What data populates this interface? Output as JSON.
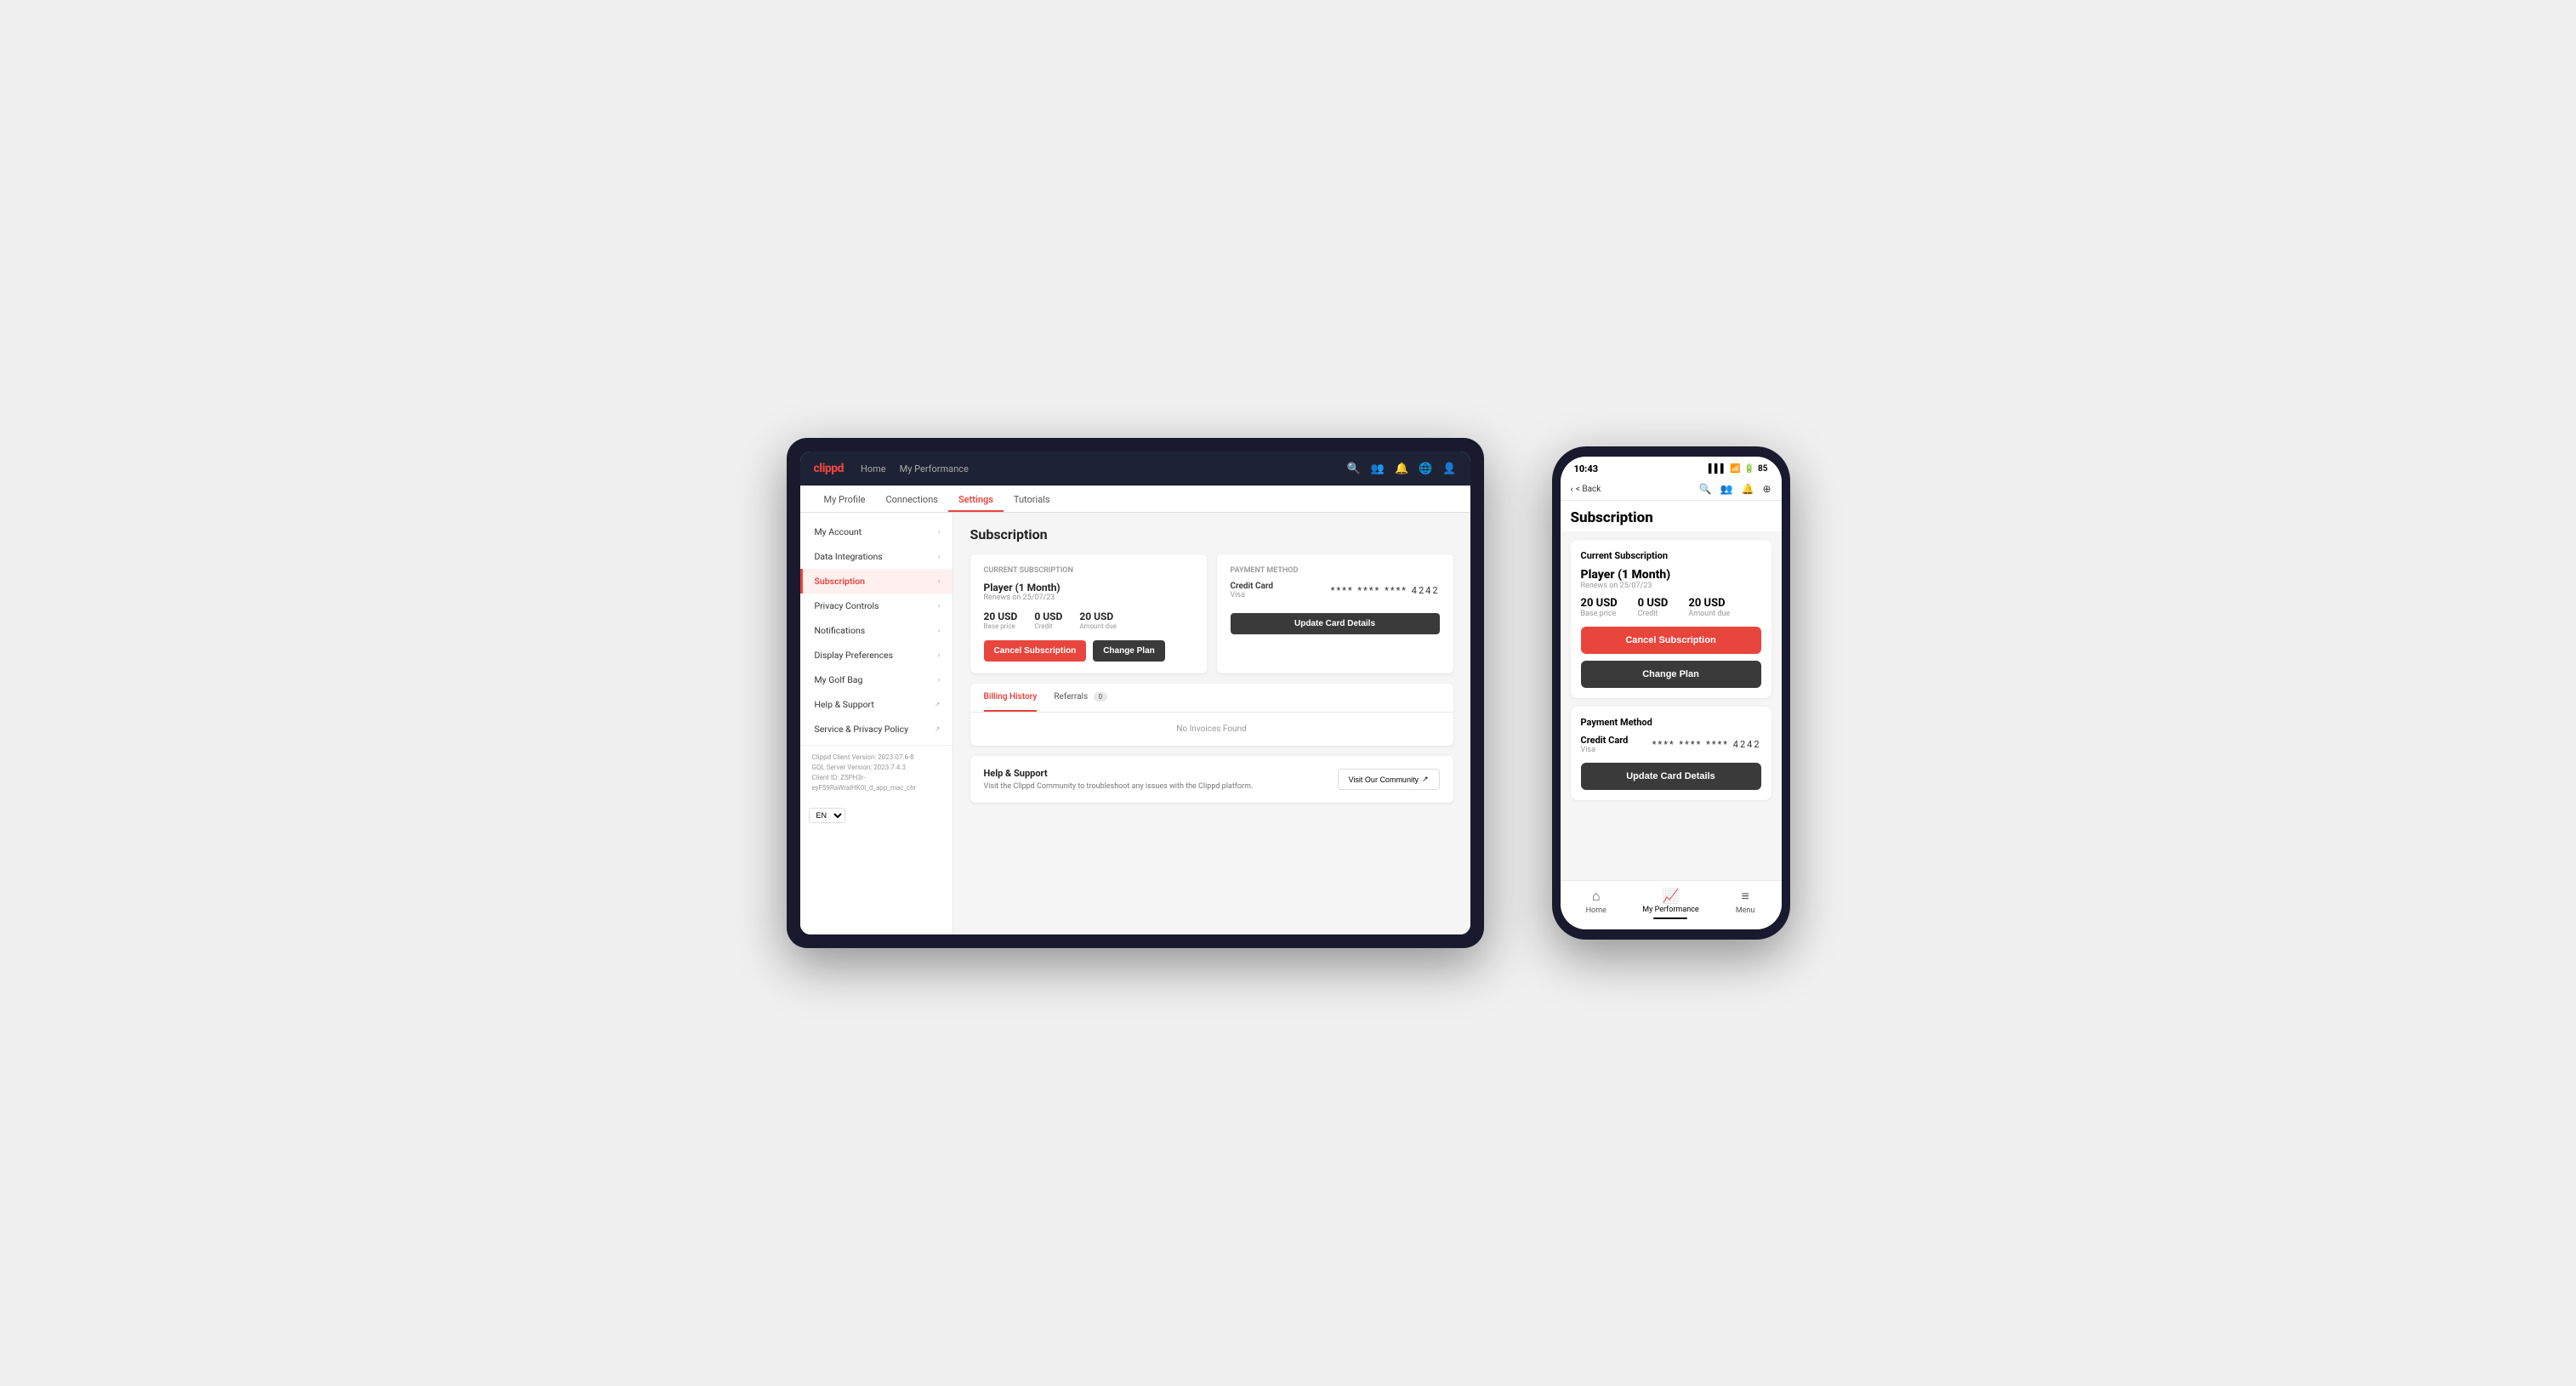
{
  "tablet": {
    "logo": "clippd",
    "nav_links": [
      "Home",
      "My Performance"
    ],
    "sub_nav": [
      "My Profile",
      "Connections",
      "Settings",
      "Tutorials"
    ],
    "active_subnav": "Settings",
    "sidebar": {
      "items": [
        {
          "label": "My Account",
          "active": false
        },
        {
          "label": "Data Integrations",
          "active": false
        },
        {
          "label": "Subscription",
          "active": true
        },
        {
          "label": "Privacy Controls",
          "active": false
        },
        {
          "label": "Notifications",
          "active": false
        },
        {
          "label": "Display Preferences",
          "active": false
        },
        {
          "label": "My Golf Bag",
          "active": false
        },
        {
          "label": "Help & Support",
          "active": false,
          "external": true
        },
        {
          "label": "Service & Privacy Policy",
          "active": false,
          "external": true
        }
      ],
      "footer": {
        "client_version": "Clippd Client Version: 2023.07.6-8",
        "gql_version": "GQL Server Version: 2023.7.4.3",
        "client_id": "Client ID: Z5PH3r-eyF59RaWralHK0l_d_app_mac_chr"
      },
      "lang": "EN"
    },
    "subscription": {
      "page_title": "Subscription",
      "current_subscription_label": "Current Subscription",
      "plan_name": "Player (1 Month)",
      "renew_date": "Renews on 25/07/23",
      "base_price_value": "20 USD",
      "base_price_label": "Base price",
      "credit_value": "0 USD",
      "credit_label": "Credit",
      "amount_due_value": "20 USD",
      "amount_due_label": "Amount due",
      "cancel_btn": "Cancel Subscription",
      "change_btn": "Change Plan",
      "payment_method_label": "Payment Method",
      "payment_type": "Credit Card",
      "payment_brand": "Visa",
      "card_number": "**** **** **** 4242",
      "update_btn": "Update Card Details",
      "billing_tab": "Billing History",
      "referrals_tab": "Referrals",
      "referrals_count": "0",
      "no_invoices": "No Invoices Found",
      "help_title": "Help & Support",
      "help_desc": "Visit the Clippd Community to troubleshoot any issues with the Clippd platform.",
      "community_btn": "Visit Our Community"
    }
  },
  "phone": {
    "status_time": "10:43",
    "status_signal": "▌▌▌",
    "status_wifi": "WiFi",
    "status_battery": "85",
    "back_label": "< Back",
    "page_title": "Subscription",
    "current_subscription_label": "Current Subscription",
    "plan_name": "Player (1 Month)",
    "renew_date": "Renews on 25/07/23",
    "base_price_value": "20 USD",
    "base_price_label": "Base price",
    "credit_value": "0 USD",
    "credit_label": "Credit",
    "amount_due_value": "20 USD",
    "amount_due_label": "Amount due",
    "cancel_btn": "Cancel Subscription",
    "change_btn": "Change Plan",
    "payment_method_label": "Payment Method",
    "payment_type": "Credit Card",
    "payment_brand": "Visa",
    "card_number": "**** **** **** 4242",
    "update_btn": "Update Card Details",
    "bottom_nav": [
      {
        "label": "Home",
        "icon": "⌂",
        "active": false
      },
      {
        "label": "My Performance",
        "icon": "↗",
        "active": true
      },
      {
        "label": "Menu",
        "icon": "≡",
        "active": false
      }
    ]
  }
}
